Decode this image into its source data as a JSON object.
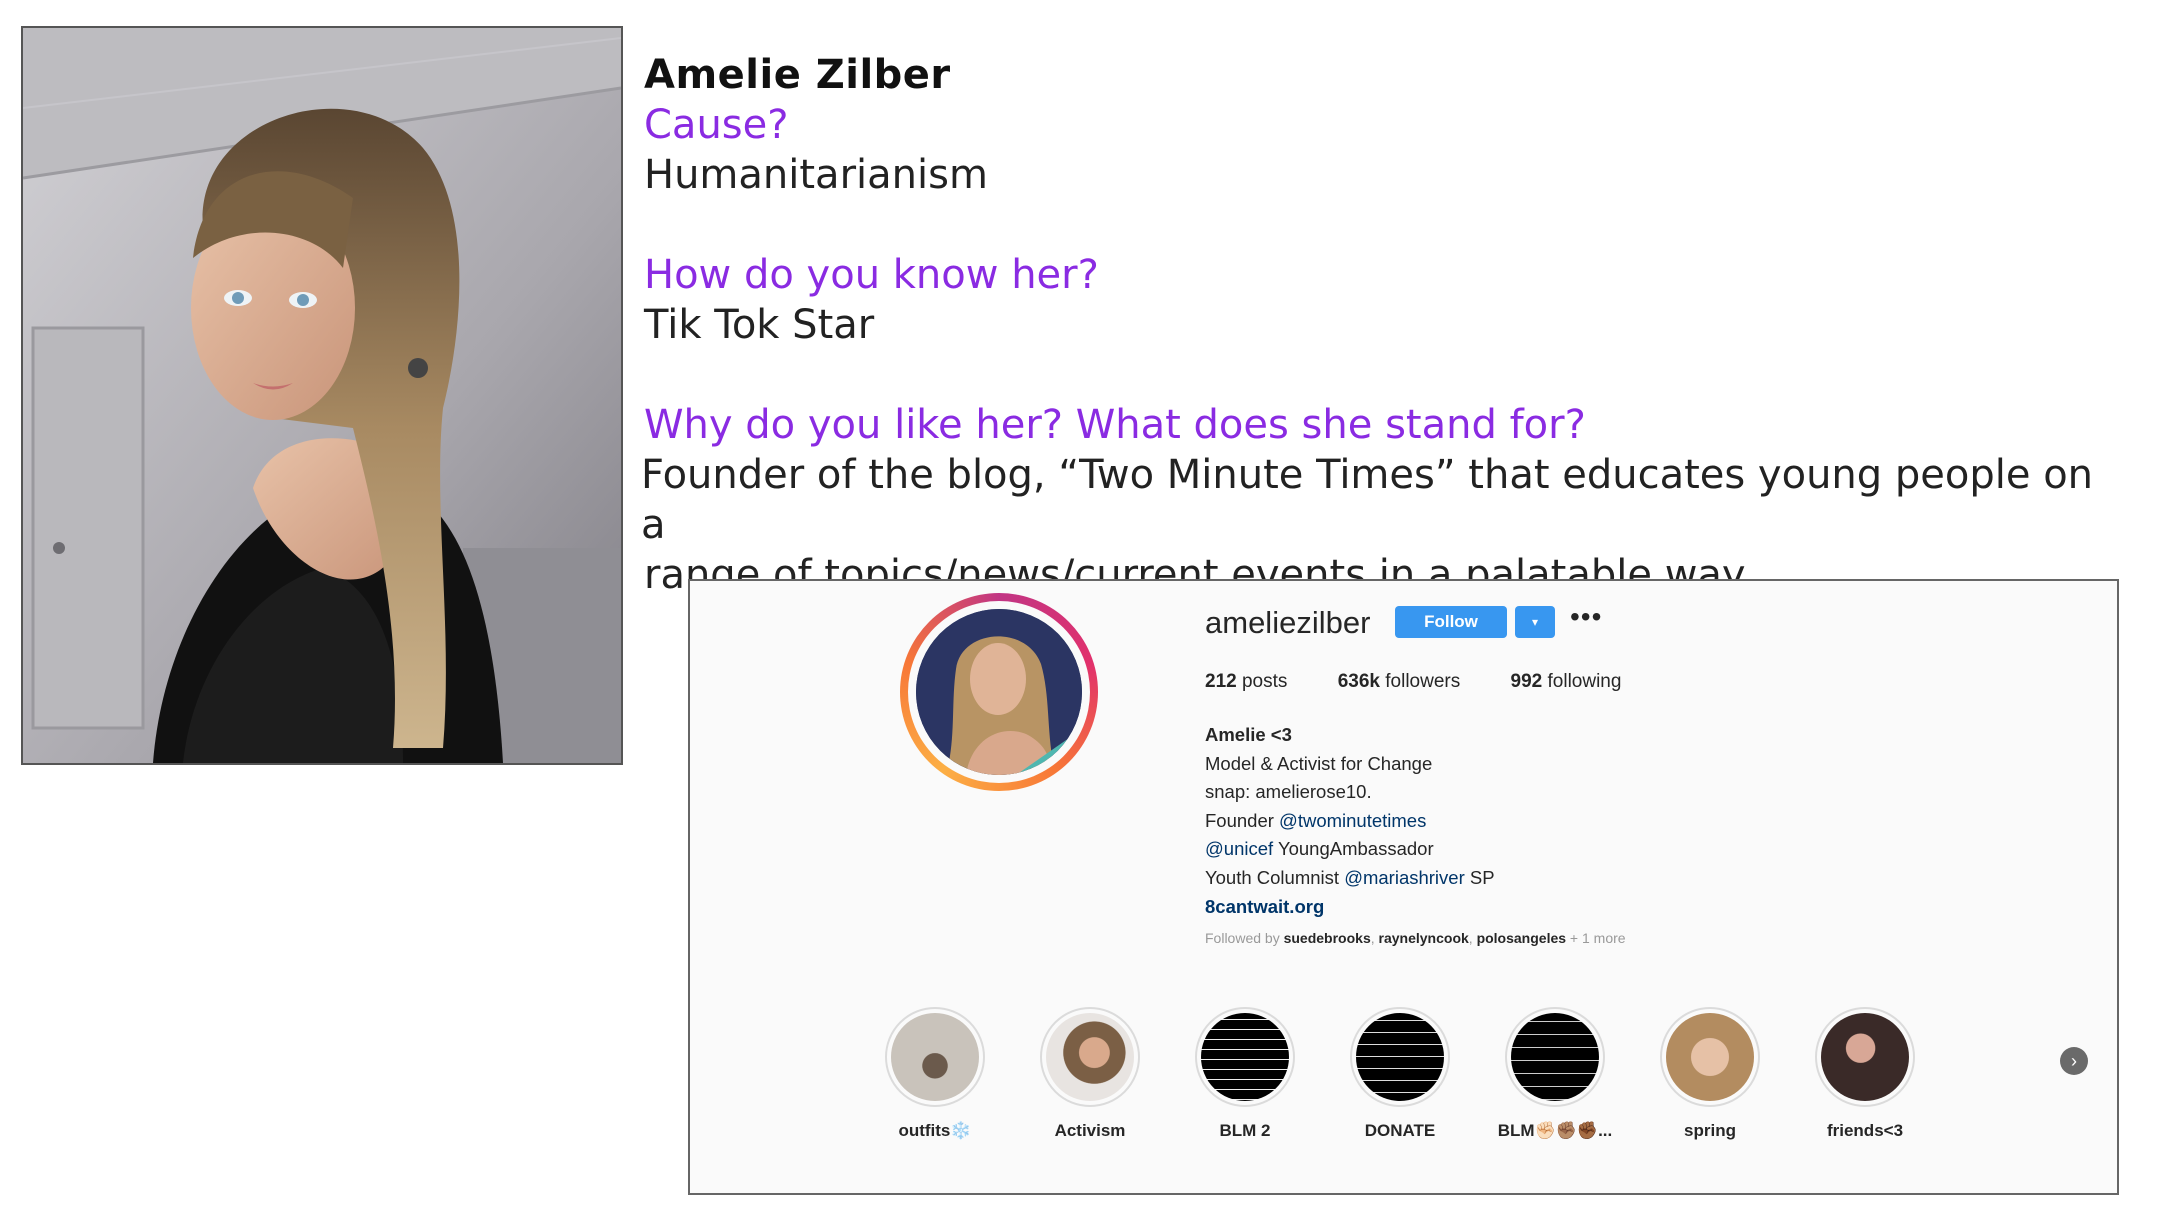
{
  "slide": {
    "name": "Amelie Zilber",
    "q_cause": "Cause?",
    "a_cause": "Humanitarianism",
    "q_know": "How do you know her?",
    "a_know": "Tik Tok Star",
    "q_why": "Why do you like her? What does she stand for?",
    "a_why_line1": "Founder of the blog, “Two Minute Times” that educates young people on a",
    "a_why_line2": "range of topics/news/current events in a palatable way"
  },
  "profile": {
    "username": "ameliezilber",
    "follow_label": "Follow",
    "dropdown_icon": "▾",
    "more_icon": "•••",
    "stats": {
      "posts_count": "212",
      "posts_label": "posts",
      "followers_count": "636k",
      "followers_label": "followers",
      "following_count": "992",
      "following_label": "following"
    },
    "bio": {
      "display_name": "Amelie <3",
      "line1": "Model & Activist for Change",
      "line2": "snap: amelierose10.",
      "line3_prefix": "Founder ",
      "line3_mention": "@twominutetimes",
      "line4_mention": "@unicef",
      "line4_suffix": " YoungAmbassador",
      "line5_prefix": "Youth Columnist ",
      "line5_mention": "@mariashriver",
      "line5_suffix": " SP",
      "website": "8cantwait.org"
    },
    "followed_by": {
      "prefix": "Followed by ",
      "user1": "suedebrooks",
      "sep1": ", ",
      "user2": "raynelyncook",
      "sep2": ", ",
      "user3": "polosangeles",
      "more": " + 1 more"
    },
    "highlights": [
      {
        "label": "outfits❄️"
      },
      {
        "label": "Activism"
      },
      {
        "label": "BLM 2"
      },
      {
        "label": "DONATE"
      },
      {
        "label": "BLM✊🏻✊🏽✊🏾..."
      },
      {
        "label": "spring"
      },
      {
        "label": "friends<3"
      }
    ],
    "next_icon": "›",
    "colors": {
      "accent_question": "#8a2be2",
      "follow_button": "#3897f0",
      "mention": "#003569"
    }
  }
}
